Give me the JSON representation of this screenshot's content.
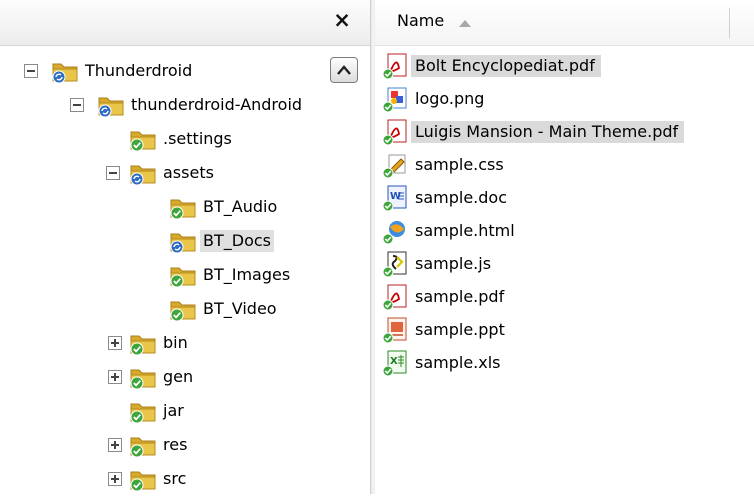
{
  "tree_header": {
    "close_glyph": "×"
  },
  "tree": [
    {
      "label": "Thunderdroid",
      "expander": "minus",
      "icon": "folder-svn-icon",
      "selected": false
    },
    {
      "label": "thunderdroid-Android",
      "expander": "minus",
      "icon": "folder-svn-icon",
      "selected": false
    },
    {
      "label": ".settings",
      "expander": "none",
      "icon": "folder-ok-icon",
      "selected": false
    },
    {
      "label": "assets",
      "expander": "minus",
      "icon": "folder-svn-icon",
      "selected": false
    },
    {
      "label": "BT_Audio",
      "expander": "none",
      "icon": "folder-ok-icon",
      "selected": false
    },
    {
      "label": "BT_Docs",
      "expander": "none",
      "icon": "folder-svn-icon",
      "selected": true
    },
    {
      "label": "BT_Images",
      "expander": "none",
      "icon": "folder-ok-icon",
      "selected": false
    },
    {
      "label": "BT_Video",
      "expander": "none",
      "icon": "folder-ok-icon",
      "selected": false
    },
    {
      "label": "bin",
      "expander": "plus",
      "icon": "folder-ok-icon",
      "selected": false
    },
    {
      "label": "gen",
      "expander": "plus",
      "icon": "folder-ok-icon",
      "selected": false
    },
    {
      "label": "jar",
      "expander": "none",
      "icon": "folder-ok-icon",
      "selected": false
    },
    {
      "label": "res",
      "expander": "plus",
      "icon": "folder-ok-icon",
      "selected": false
    },
    {
      "label": "src",
      "expander": "plus",
      "icon": "folder-ok-icon",
      "selected": false
    }
  ],
  "file_list": {
    "column_header": "Name",
    "sort": "ascending",
    "files": [
      {
        "name": "Bolt Encyclopediat.pdf",
        "icon": "pdf-file-icon",
        "selected": true
      },
      {
        "name": "logo.png",
        "icon": "image-file-icon",
        "selected": false
      },
      {
        "name": "Luigis Mansion - Main Theme.pdf",
        "icon": "pdf-file-icon",
        "selected": true
      },
      {
        "name": "sample.css",
        "icon": "css-file-icon",
        "selected": false
      },
      {
        "name": "sample.doc",
        "icon": "word-file-icon",
        "selected": false
      },
      {
        "name": "sample.html",
        "icon": "html-file-icon",
        "selected": false
      },
      {
        "name": "sample.js",
        "icon": "js-file-icon",
        "selected": false
      },
      {
        "name": "sample.pdf",
        "icon": "pdf-file-icon",
        "selected": false
      },
      {
        "name": "sample.ppt",
        "icon": "powerpoint-file-icon",
        "selected": false
      },
      {
        "name": "sample.xls",
        "icon": "excel-file-icon",
        "selected": false
      }
    ]
  },
  "colors": {
    "folder": "#e9c64a",
    "svn_badge": "#2f6cc4",
    "ok_badge": "#3da53a",
    "selection": "#dadada"
  }
}
